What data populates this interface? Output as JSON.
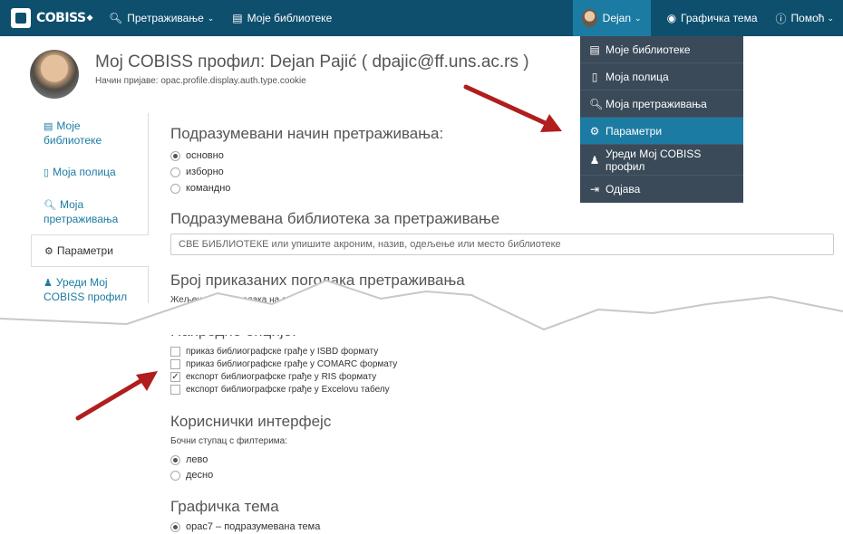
{
  "nav": {
    "logo": "COBISS",
    "search_label": "Претраживање",
    "libraries_label": "Моје библиотеке",
    "user_label": "Dejan",
    "theme_label": "Графичка тема",
    "help_label": "Помоћ"
  },
  "dropdown": {
    "items": [
      {
        "label": "Моје библиотеке",
        "icon": "library-icon"
      },
      {
        "label": "Моја полица",
        "icon": "bookmark-icon"
      },
      {
        "label": "Моја претраживања",
        "icon": "search-icon"
      },
      {
        "label": "Параметри",
        "icon": "gears-icon",
        "selected": true
      },
      {
        "label": "Уреди Мој COBISS профил",
        "icon": "user-icon"
      },
      {
        "label": "Одјава",
        "icon": "sign-out-icon"
      }
    ]
  },
  "profile": {
    "title": "Мој COBISS профил: Dejan Pajić ( dpajic@ff.uns.ac.rs )",
    "login_text": "Начин пријаве: opac.profile.display.auth.type.cookie"
  },
  "tabs": [
    {
      "label": "Моје библиотеке",
      "icon": "library-icon"
    },
    {
      "label": "Моја полица",
      "icon": "bookmark-icon"
    },
    {
      "label": "Моја претраживања",
      "icon": "search-icon"
    },
    {
      "label": "Параметри",
      "icon": "gears-icon"
    },
    {
      "label": "Уреди Мој COBISS профил",
      "icon": "user-icon"
    }
  ],
  "search_mode": {
    "heading": "Подразумевани начин претраживања:",
    "options": [
      "основно",
      "изборно",
      "командно"
    ],
    "selected": "основно"
  },
  "library": {
    "heading": "Подразумевана библиотека за претраживање",
    "placeholder": "СВЕ БИБЛИОТЕКЕ или упишите акроним, назив, одељење или место библиотеке"
  },
  "hits": {
    "heading": "Број приказаних погодака претраживања",
    "label": "Жељени број погодака на страници:"
  },
  "advanced": {
    "heading": "Напредне опције:",
    "options": [
      {
        "label": "приказ библиографске грађе у ISBD формату",
        "checked": false
      },
      {
        "label": "приказ библиографске грађе у COMARC формату",
        "checked": false
      },
      {
        "label": "експорт библиографске грађе у RIS формату",
        "checked": true
      },
      {
        "label": "експорт библиографске грађе у Excelovu табелу",
        "checked": false
      }
    ]
  },
  "ui": {
    "heading": "Кориснички интерфејс",
    "label": "Бочни ступац с филтерима:",
    "options": [
      "лево",
      "десно"
    ],
    "selected": "лево"
  },
  "theme": {
    "heading": "Графичка тема",
    "option": "opac7 – подразумевана тема"
  },
  "colors": {
    "navbar": "#0e4f6e",
    "accent": "#1c7ba3",
    "dropdown": "#3b4a58",
    "arrow": "#b01e1e"
  }
}
